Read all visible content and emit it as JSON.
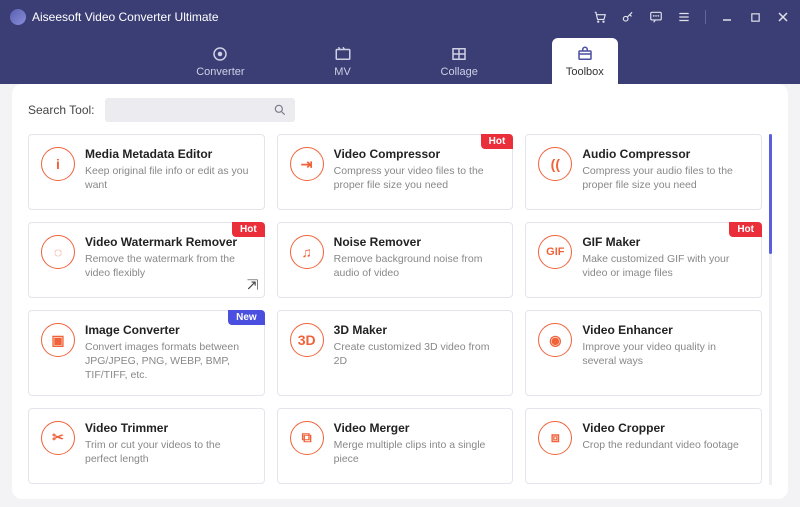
{
  "app_title": "Aiseesoft Video Converter Ultimate",
  "nav": {
    "converter": "Converter",
    "mv": "MV",
    "collage": "Collage",
    "toolbox": "Toolbox"
  },
  "search_label": "Search Tool:",
  "badge_labels": {
    "hot": "Hot",
    "new": "New"
  },
  "tools": [
    {
      "icon": "i",
      "title": "Media Metadata Editor",
      "desc": "Keep original file info or edit as you want"
    },
    {
      "icon": "⇥",
      "title": "Video Compressor",
      "desc": "Compress your video files to the proper file size you need",
      "badge": "hot"
    },
    {
      "icon": "((",
      "title": "Audio Compressor",
      "desc": "Compress your audio files to the proper file size you need"
    },
    {
      "icon": "◌",
      "title": "Video Watermark Remover",
      "desc": "Remove the watermark from the video flexibly",
      "badge": "hot",
      "pinned": true
    },
    {
      "icon": "♫",
      "title": "Noise Remover",
      "desc": "Remove background noise from audio of video"
    },
    {
      "icon": "GIF",
      "title": "GIF Maker",
      "desc": "Make customized GIF with your video or image files",
      "badge": "hot"
    },
    {
      "icon": "▣",
      "title": "Image Converter",
      "desc": "Convert images formats between JPG/JPEG, PNG, WEBP, BMP, TIF/TIFF, etc.",
      "badge": "new"
    },
    {
      "icon": "3D",
      "title": "3D Maker",
      "desc": "Create customized 3D video from 2D"
    },
    {
      "icon": "◉",
      "title": "Video Enhancer",
      "desc": "Improve your video quality in several ways"
    },
    {
      "icon": "✂",
      "title": "Video Trimmer",
      "desc": "Trim or cut your videos to the perfect length"
    },
    {
      "icon": "⧉",
      "title": "Video Merger",
      "desc": "Merge multiple clips into a single piece"
    },
    {
      "icon": "⧈",
      "title": "Video Cropper",
      "desc": "Crop the redundant video footage"
    }
  ]
}
